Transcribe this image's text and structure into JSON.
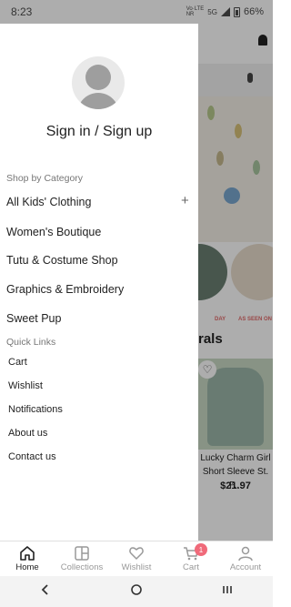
{
  "status_bar": {
    "time": "8:23",
    "network_top": "Vo·LTE",
    "network_bottom": "NR",
    "network_type": "5G",
    "battery": "66%"
  },
  "drawer": {
    "auth_label": "Sign in / Sign up",
    "category_header": "Shop by Category",
    "categories": [
      {
        "label": "All Kids' Clothing",
        "expand": "+"
      },
      {
        "label": "Women's Boutique"
      },
      {
        "label": "Tutu & Costume Shop"
      },
      {
        "label": "Graphics & Embroidery"
      },
      {
        "label": "Sweet Pup"
      }
    ],
    "quick_links_header": "Quick Links",
    "quick_links": [
      "Cart",
      "Wishlist",
      "Notifications",
      "About us",
      "Contact us"
    ]
  },
  "background": {
    "banner_label_left": "DAY",
    "banner_label_right": "AS SEEN ON",
    "section_title": "rals",
    "product_name": "Lucky Charm Girl Short Sleeve St. P...",
    "product_price": "$21.97"
  },
  "bottom_nav": {
    "tabs": [
      {
        "label": "Home",
        "icon": "home-icon"
      },
      {
        "label": "Collections",
        "icon": "collections-icon"
      },
      {
        "label": "Wishlist",
        "icon": "heart-icon"
      },
      {
        "label": "Cart",
        "icon": "cart-icon",
        "badge": "1"
      },
      {
        "label": "Account",
        "icon": "account-icon"
      }
    ]
  },
  "colors": {
    "badge": "#f06a7a",
    "scrim": "rgba(0,0,0,0.32)",
    "accent_text": "#222222"
  }
}
